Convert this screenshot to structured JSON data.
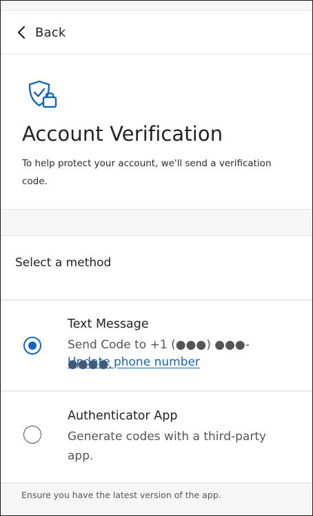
{
  "header": {
    "back_label": "Back"
  },
  "verification": {
    "title": "Account Verification",
    "description": "To help protect your account, we'll send a verification code.",
    "icon": "shield-check-lock-icon",
    "accent_color": "#1565c0"
  },
  "methods": {
    "heading": "Select a method",
    "options": [
      {
        "title": "Text Message",
        "description": "Send Code to +1 (●●●) ●●●-●●●●.",
        "link": "Update phone number",
        "selected": true
      },
      {
        "title": "Authenticator App",
        "description": "Generate codes with a third-party app.",
        "selected": false
      }
    ]
  },
  "footer": {
    "note": "Ensure you have the latest version of the app."
  }
}
